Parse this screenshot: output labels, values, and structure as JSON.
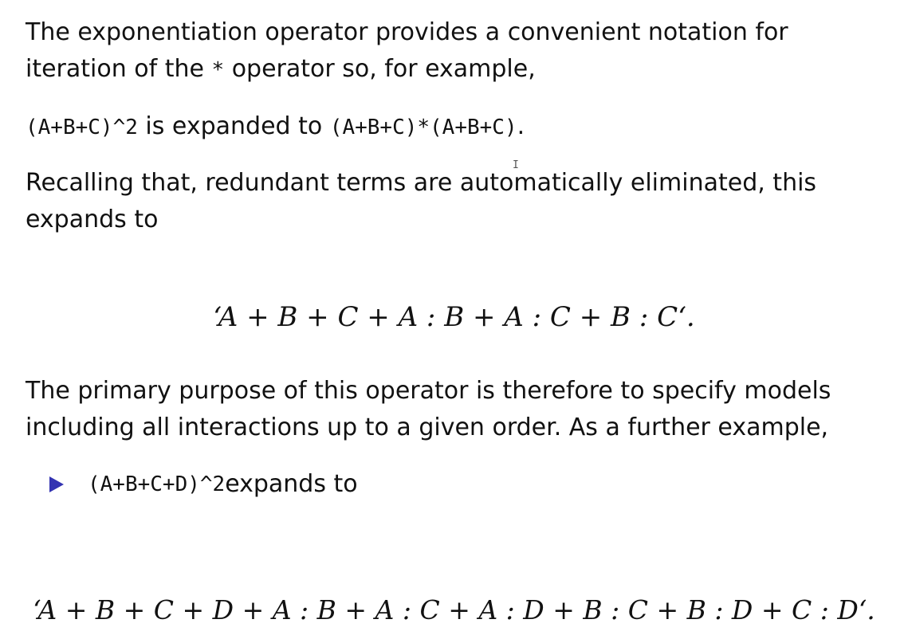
{
  "paragraph_1": {
    "line_1": "The exponentiation operator provides a convenient notation for",
    "line_2_before": "iteration of the ",
    "line_2_code": "*",
    "line_2_after": " operator so, for example,"
  },
  "paragraph_2": {
    "code_1": "(A+B+C)^2",
    "middle": " is expanded to ",
    "code_2": "(A+B+C)*(A+B+C)",
    "end": "."
  },
  "paragraph_3": {
    "line_1": "Recalling that, redundant terms are automatically eliminated, this",
    "line_2": "expands to"
  },
  "formula_1": "‘A + B + C + A : B + A : C + B : C‘.",
  "paragraph_4": {
    "line_1": "The primary purpose of this operator is therefore to specify models",
    "line_2": "including all interactions up to a given order. As a further example,"
  },
  "bullet": {
    "code": "(A+B+C+D)^2",
    "text": " expands to",
    "marker_color": "#3333b2"
  },
  "formula_2": "‘A + B + C + D + A : B + A : C + A : D + B : C + B : D + C : D‘.",
  "cursor": "I"
}
